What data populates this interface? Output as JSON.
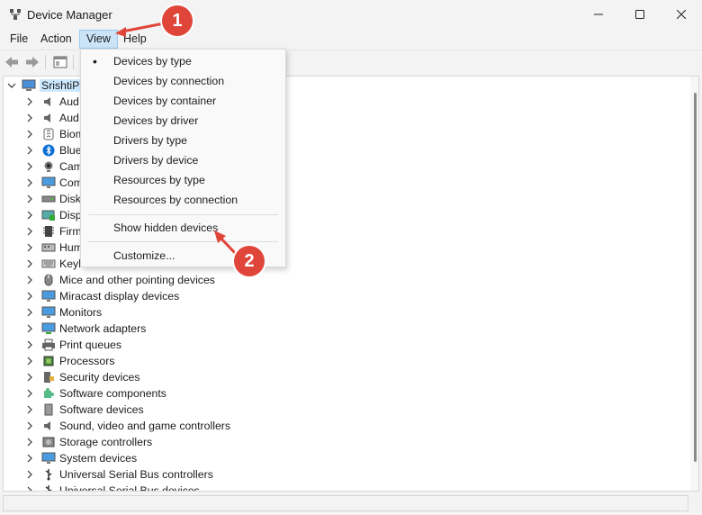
{
  "window": {
    "title": "Device Manager",
    "controls": [
      "minimize",
      "maximize",
      "close"
    ]
  },
  "menu": {
    "file": "File",
    "action": "Action",
    "view": "View",
    "help": "Help"
  },
  "tree": {
    "root": "SrishtiPC",
    "items": [
      {
        "label": "Audio inputs and outputs",
        "visible": "Aud",
        "icon": "speaker-icon"
      },
      {
        "label": "Audio Processing Objects (APOs)",
        "visible": "Aud",
        "icon": "speaker-icon"
      },
      {
        "label": "Biometric devices",
        "visible": "Biom",
        "icon": "fingerprint-icon"
      },
      {
        "label": "Bluetooth",
        "visible": "Blue",
        "icon": "bluetooth-icon"
      },
      {
        "label": "Cameras",
        "visible": "Cam",
        "icon": "camera-icon"
      },
      {
        "label": "Computer",
        "visible": "Com",
        "icon": "monitor-icon"
      },
      {
        "label": "Disk drives",
        "visible": "Disk",
        "icon": "disk-icon"
      },
      {
        "label": "Display adapters",
        "visible": "Disp",
        "icon": "display-adapter-icon"
      },
      {
        "label": "Firmware",
        "visible": "Firm",
        "icon": "chip-icon"
      },
      {
        "label": "Human Interface Devices",
        "visible": "Hum",
        "icon": "hid-icon"
      },
      {
        "label": "Keyboards",
        "visible": "Keyb",
        "icon": "keyboard-icon"
      },
      {
        "label": "Mice and other pointing devices",
        "visible": "Mice and other pointing devices",
        "icon": "mouse-icon"
      },
      {
        "label": "Miracast display devices",
        "visible": "Miracast display devices",
        "icon": "monitor-icon"
      },
      {
        "label": "Monitors",
        "visible": "Monitors",
        "icon": "monitor-icon"
      },
      {
        "label": "Network adapters",
        "visible": "Network adapters",
        "icon": "network-icon"
      },
      {
        "label": "Print queues",
        "visible": "Print queues",
        "icon": "printer-icon"
      },
      {
        "label": "Processors",
        "visible": "Processors",
        "icon": "processor-icon"
      },
      {
        "label": "Security devices",
        "visible": "Security devices",
        "icon": "security-icon"
      },
      {
        "label": "Software components",
        "visible": "Software components",
        "icon": "puzzle-icon"
      },
      {
        "label": "Software devices",
        "visible": "Software devices",
        "icon": "software-device-icon"
      },
      {
        "label": "Sound, video and game controllers",
        "visible": "Sound, video and game controllers",
        "icon": "speaker-icon"
      },
      {
        "label": "Storage controllers",
        "visible": "Storage controllers",
        "icon": "storage-icon"
      },
      {
        "label": "System devices",
        "visible": "System devices",
        "icon": "monitor-icon"
      },
      {
        "label": "Universal Serial Bus controllers",
        "visible": "Universal Serial Bus controllers",
        "icon": "usb-icon"
      },
      {
        "label": "Universal Serial Bus devices",
        "visible": "Universal Serial Bus devices",
        "icon": "usb-icon"
      }
    ]
  },
  "view_menu": {
    "items": [
      {
        "label": "Devices by type",
        "checked": true
      },
      {
        "label": "Devices by connection",
        "checked": false
      },
      {
        "label": "Devices by container",
        "checked": false
      },
      {
        "label": "Devices by driver",
        "checked": false
      },
      {
        "label": "Drivers by type",
        "checked": false
      },
      {
        "label": "Drivers by device",
        "checked": false
      },
      {
        "label": "Resources by type",
        "checked": false
      },
      {
        "label": "Resources by connection",
        "checked": false
      }
    ],
    "show_hidden": "Show hidden devices",
    "customize": "Customize...",
    "bullet": "•"
  },
  "callouts": {
    "one": "1",
    "two": "2"
  },
  "colors": {
    "callout": "#e0453a",
    "menu_active": "#cce4f7",
    "accent": "#0067c0"
  }
}
